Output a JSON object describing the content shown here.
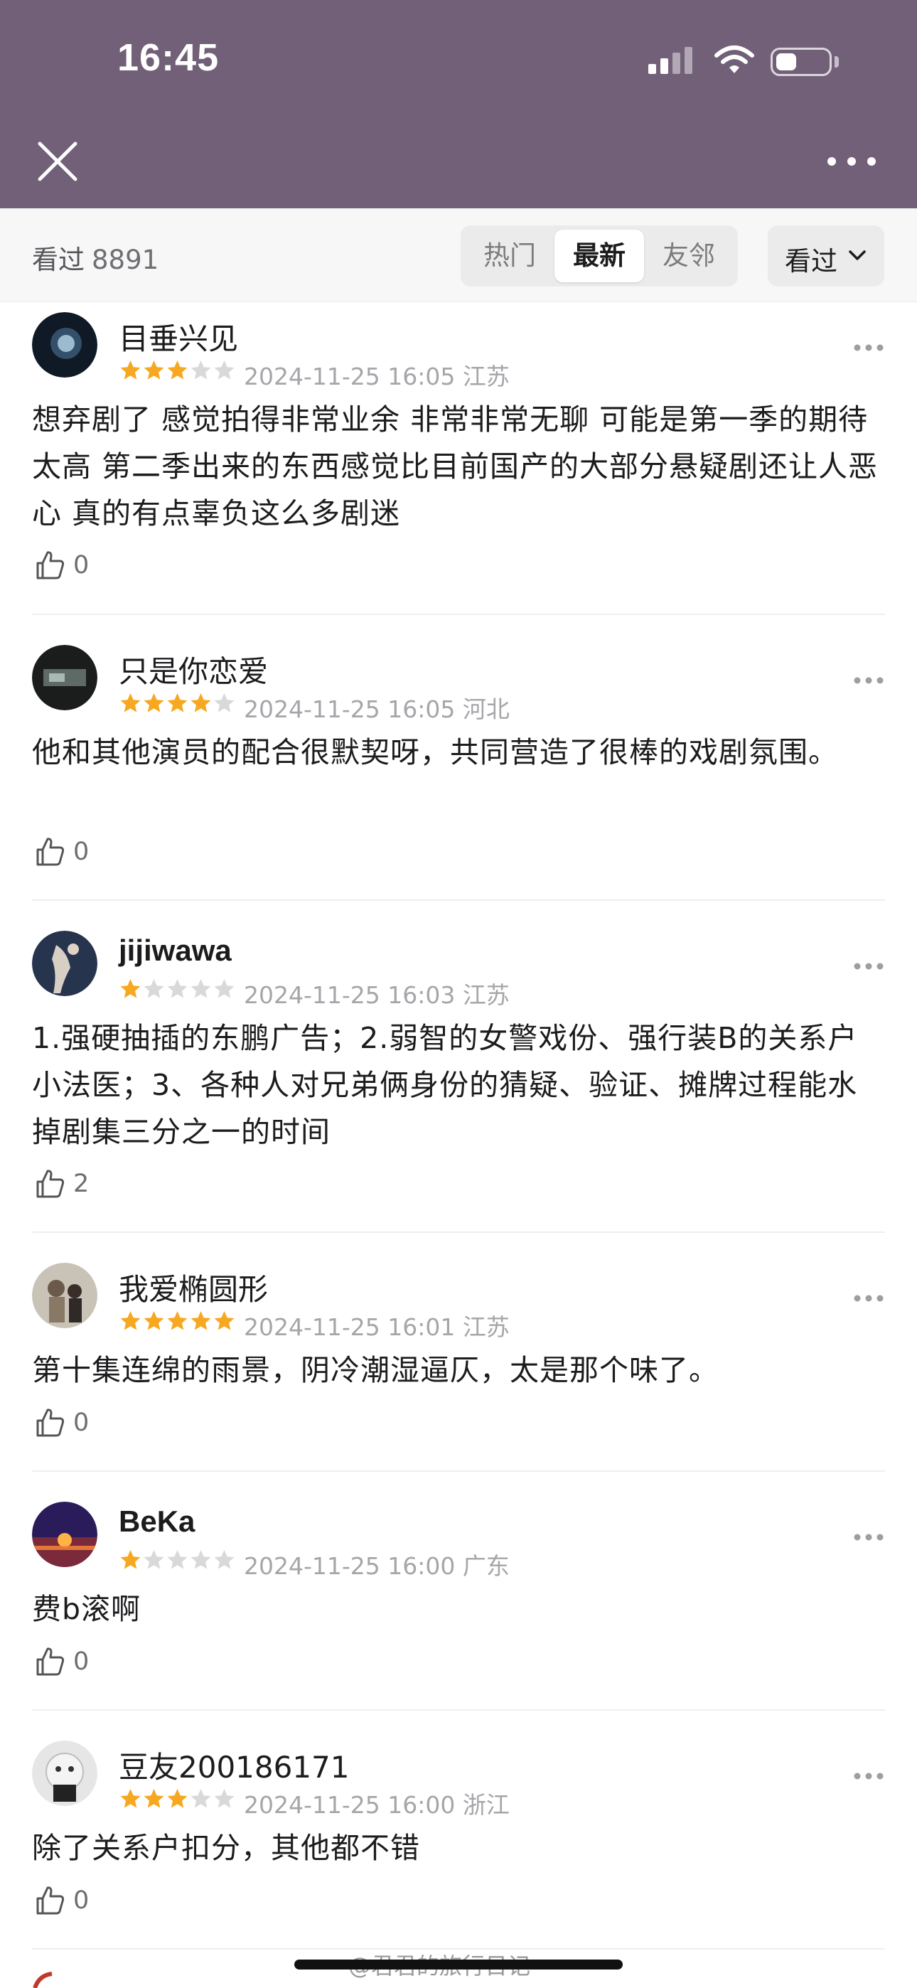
{
  "status_bar": {
    "time": "16:45",
    "battery_level": 0.4
  },
  "nav": {
    "close_icon": "close-icon",
    "more_icon": "more-dots-icon"
  },
  "filter": {
    "seen_label": "看过",
    "seen_count": "8891",
    "tabs": [
      {
        "label": "热门",
        "active": false
      },
      {
        "label": "最新",
        "active": true
      },
      {
        "label": "友邻",
        "active": false
      }
    ],
    "dropdown_label": "看过"
  },
  "comments": [
    {
      "username": "目垂兴见",
      "rating": 3,
      "time": "2024-11-25 16:05",
      "location": "江苏",
      "text": "想弃剧了 感觉拍得非常业余 非常非常无聊 可能是第一季的期待太高 第二季出来的东西感觉比目前国产的大部分悬疑剧还让人恶心 真的有点辜负这么多剧迷",
      "likes": "0"
    },
    {
      "username": "只是你恋爱",
      "rating": 4,
      "time": "2024-11-25 16:05",
      "location": "河北",
      "text": "他和其他演员的配合很默契呀，共同营造了很棒的戏剧氛围。",
      "likes": "0"
    },
    {
      "username": "jijiwawa",
      "rating": 1,
      "time": "2024-11-25 16:03",
      "location": "江苏",
      "text": "1.强硬抽插的东鹏广告；2.弱智的女警戏份、强行装B的关系户小法医；3、各种人对兄弟俩身份的猜疑、验证、摊牌过程能水掉剧集三分之一的时间",
      "likes": "2"
    },
    {
      "username": "我爱椭圆形",
      "rating": 5,
      "time": "2024-11-25 16:01",
      "location": "江苏",
      "text": "第十集连绵的雨景，阴冷潮湿逼仄，太是那个味了。",
      "likes": "0"
    },
    {
      "username": "BeKa",
      "rating": 1,
      "time": "2024-11-25 16:00",
      "location": "广东",
      "text": "费b滚啊",
      "likes": "0"
    },
    {
      "username": "豆友200186171",
      "rating": 3,
      "time": "2024-11-25 16:00",
      "location": "浙江",
      "text": "除了关系户扣分，其他都不错",
      "likes": "0"
    }
  ],
  "watermark": "@君君的旅行日记",
  "colors": {
    "header": "#725f78",
    "star_on": "#f7a821",
    "star_off": "#d9d9d9"
  }
}
